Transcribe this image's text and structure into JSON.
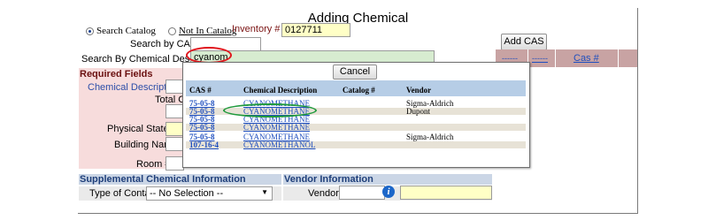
{
  "page": {
    "title": "Adding Chemical"
  },
  "search": {
    "option_catalog": "Search Catalog",
    "option_not_in_catalog": "Not In Catalog",
    "inventory_label": "Inventory #",
    "inventory_value": "0127711",
    "cas_label": "Search by CAS #",
    "cas_value": "",
    "desc_label": "Search By Chemical Description",
    "desc_value": "cyanom"
  },
  "add_cas_button": "Add CAS #",
  "right_table": {
    "col1": "------",
    "col2": "------",
    "col3": "Cas #"
  },
  "required": {
    "header": "Required Fields",
    "chemical_description": "Chemical Description",
    "total_container": "Total Con",
    "physical_state": "Physical State",
    "building_name": "Building Name",
    "room": "Room #"
  },
  "popup": {
    "cancel": "Cancel",
    "headers": [
      "CAS #",
      "Chemical Description",
      "Catalog #",
      "Vendor"
    ],
    "rows": [
      {
        "cas": "75-05-8",
        "desc": "CYANOMETHANE",
        "catalog": "",
        "vendor": "Sigma-Aldrich"
      },
      {
        "cas": "75-05-8",
        "desc": "CYANOMETHANE",
        "catalog": "",
        "vendor": "Dupont"
      },
      {
        "cas": "75-05-8",
        "desc": "CYANOMETHANE",
        "catalog": "",
        "vendor": ""
      },
      {
        "cas": "75-05-8",
        "desc": "CYANOMETHANE",
        "catalog": "",
        "vendor": ""
      },
      {
        "cas": "75-05-8",
        "desc": "CYANOMETHANE",
        "catalog": "",
        "vendor": "Sigma-Aldrich"
      },
      {
        "cas": "107-16-4",
        "desc": "CYANOMETHANOL",
        "catalog": "",
        "vendor": ""
      }
    ]
  },
  "supplemental": {
    "header": "Supplemental Chemical Information",
    "type_label": "Type of Container",
    "type_value": "-- No Selection --"
  },
  "vendor_info": {
    "header": "Vendor Information",
    "vendor_label": "Vendor",
    "vendor_value": ""
  },
  "colors": {
    "required_bg": "#f7dcdc",
    "section_bar": "#cbd6e6",
    "popup_header": "#b6cde6",
    "highlight_input": "#ffffc6",
    "description_input": "#d7ecd0",
    "red_annotation": "#e0161d",
    "green_annotation": "#1f9a3c"
  },
  "icons": [
    "radio-selected",
    "radio-unselected",
    "info-icon",
    "dropdown-arrow-icon"
  ]
}
